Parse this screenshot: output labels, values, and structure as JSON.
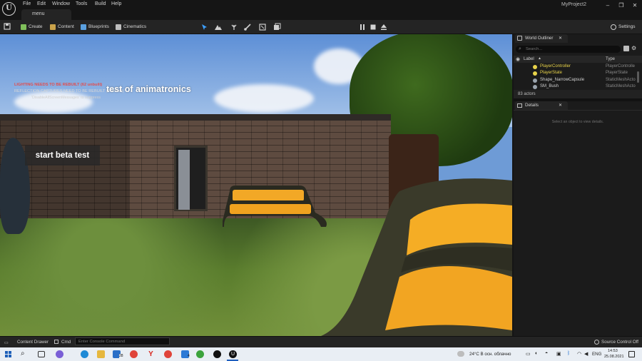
{
  "menu": {
    "items": [
      "File",
      "Edit",
      "Window",
      "Tools",
      "Build",
      "Help"
    ]
  },
  "level_tab": "menu",
  "project_name": "MyProject2",
  "toolbar": {
    "create": "Create",
    "content": "Content",
    "blueprints": "Blueprints",
    "cinematics": "Cinematics",
    "settings": "Settings"
  },
  "viewport": {
    "warning_lighting": "LIGHTING NEEDS TO BE REBUILT (62 unbuilt)",
    "warning_reflection": "REFLECTION CAPTURES NEED TO BE REBUILT (4 unbuilt)",
    "warning_suppress": "'DisableAllScreenMessages' to suppress",
    "title": "test of animatronics",
    "beta_button": "start beta test"
  },
  "outliner": {
    "tab_label": "World Outliner",
    "search_placeholder": "Search...",
    "col_label": "Label",
    "col_type": "Type",
    "rows": [
      {
        "label": "PlayerController",
        "type": "PlayerControlle",
        "color": "#e8d34a"
      },
      {
        "label": "PlayerState",
        "type": "PlayerState",
        "color": "#e8d34a"
      },
      {
        "label": "Shape_NarrowCapsule",
        "type": "StaticMeshActo",
        "color": "#9aa3ad"
      },
      {
        "label": "SM_Bush",
        "type": "StaticMeshActo",
        "color": "#9aa3ad"
      }
    ],
    "actor_count": "83 actors"
  },
  "details": {
    "tab_label": "Details",
    "hint": "Select an object to view details."
  },
  "statusbar": {
    "content_drawer": "Content Drawer",
    "cmd": "Cmd",
    "console_placeholder": "Enter Console Command",
    "source_control": "Source Control Off"
  },
  "taskbar": {
    "weather": "24°C В осн. облачно",
    "lang": "ENG",
    "time": "14:53",
    "date": "25.08.2021",
    "mail_badge": "28",
    "notif_badge": "4"
  },
  "colors": {
    "accent": "#e8d34a",
    "warning": "#e34c4c"
  }
}
